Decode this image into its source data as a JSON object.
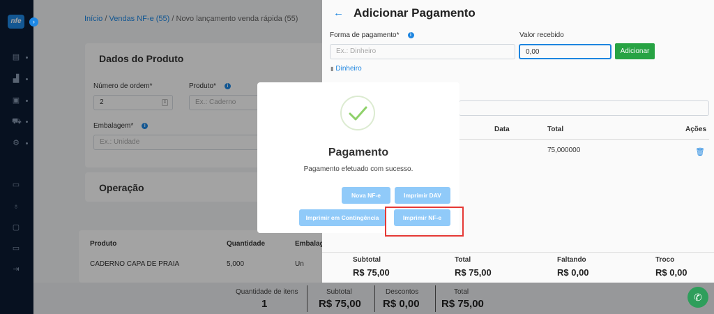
{
  "sidebar": {
    "logo": "nfe",
    "toggle": "›",
    "icons": [
      "list-icon",
      "chart-icon",
      "image-icon",
      "cart-icon",
      "gear-icon",
      "chat-icon",
      "mic-icon",
      "lock-icon",
      "monitor-icon",
      "logout-icon"
    ]
  },
  "breadcrumb": {
    "home": "Início",
    "sep1": "/",
    "sales": "Vendas NF-e (55)",
    "sep2": "/",
    "current": "Novo lançamento venda rápida (55)"
  },
  "product_card": {
    "title": "Dados do Produto",
    "order_label": "Número de ordem*",
    "order_value": "2",
    "product_label": "Produto*",
    "product_placeholder": "Ex.: Caderno",
    "package_label": "Embalagem*",
    "package_placeholder": "Ex.: Unidade"
  },
  "operation_card": {
    "title": "Operação"
  },
  "items_table": {
    "headers": [
      "Produto",
      "Quantidade",
      "Embalage"
    ],
    "rows": [
      [
        "CADERNO CAPA DE PRAIA",
        "5,000",
        "Un"
      ]
    ]
  },
  "footer": {
    "items_label": "Quantidade de itens",
    "items_value": "1",
    "subtotal_label": "Subtotal",
    "subtotal_value": "R$ 75,00",
    "discount_label": "Descontos",
    "discount_value": "R$ 0,00",
    "total_label": "Total",
    "total_value": "R$ 75,00"
  },
  "payment_panel": {
    "title": "Adicionar Pagamento",
    "method_label": "Forma de pagamento*",
    "method_placeholder": "Ex.: Dinheiro",
    "amount_label": "Valor recebido",
    "amount_value": "0,00",
    "add_button": "Adicionar",
    "selected_method": "Dinheiro",
    "table_headers": [
      "Data",
      "Total",
      "Ações"
    ],
    "table_total": "75,000000",
    "summary": [
      {
        "label": "Subtotal",
        "value": "R$ 75,00"
      },
      {
        "label": "Total",
        "value": "R$ 75,00"
      },
      {
        "label": "Faltando",
        "value": "R$ 0,00"
      },
      {
        "label": "Troco",
        "value": "R$ 0,00"
      }
    ]
  },
  "modal": {
    "title": "Pagamento",
    "message": "Pagamento efetuado com sucesso.",
    "btn_new": "Nova NF-e",
    "btn_dav": "Imprimir DAV",
    "btn_contingency": "Imprimir em Contingência",
    "btn_print": "Imprimir NF-e"
  },
  "colors": {
    "accent": "#1e88e5",
    "success": "#28a745",
    "modal_button": "#90caf9",
    "highlight": "#e53935",
    "sidebar": "#0c1c33"
  }
}
